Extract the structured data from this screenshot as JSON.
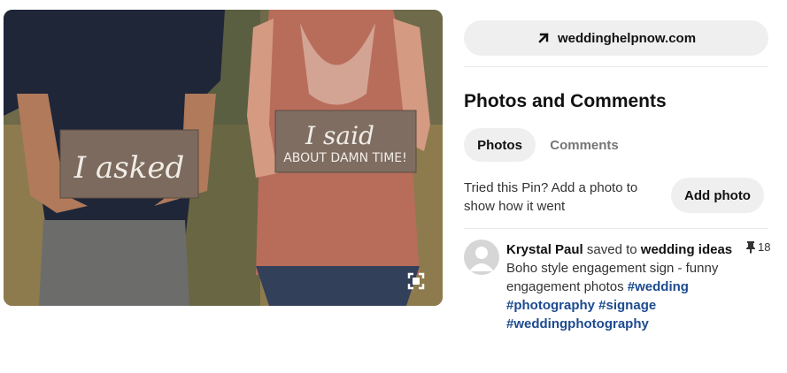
{
  "link": {
    "text": "weddinghelpnow.com",
    "icon": "arrow-up-right-icon"
  },
  "section": {
    "title": "Photos and Comments"
  },
  "tabs": [
    {
      "label": "Photos",
      "active": true
    },
    {
      "label": "Comments",
      "active": false
    }
  ],
  "tried": {
    "text": "Tried this Pin? Add a photo to show how it went",
    "button": "Add photo"
  },
  "comment": {
    "user": "Krystal Paul",
    "saved_to": "saved to",
    "board": "wedding ideas",
    "description": "Boho style engagement sign - funny engagement photos",
    "hashtags": [
      "#wedding",
      "#photography",
      "#signage",
      "#weddingphotography"
    ],
    "pin_count": "18"
  },
  "image": {
    "sign_left": "I asked",
    "sign_right_line1": "I said",
    "sign_right_line2": "ABOUT DAMN TIME!"
  },
  "colors": {
    "pill_bg": "#efefef",
    "hashtag": "#1d4b8f",
    "muted": "#767676"
  }
}
